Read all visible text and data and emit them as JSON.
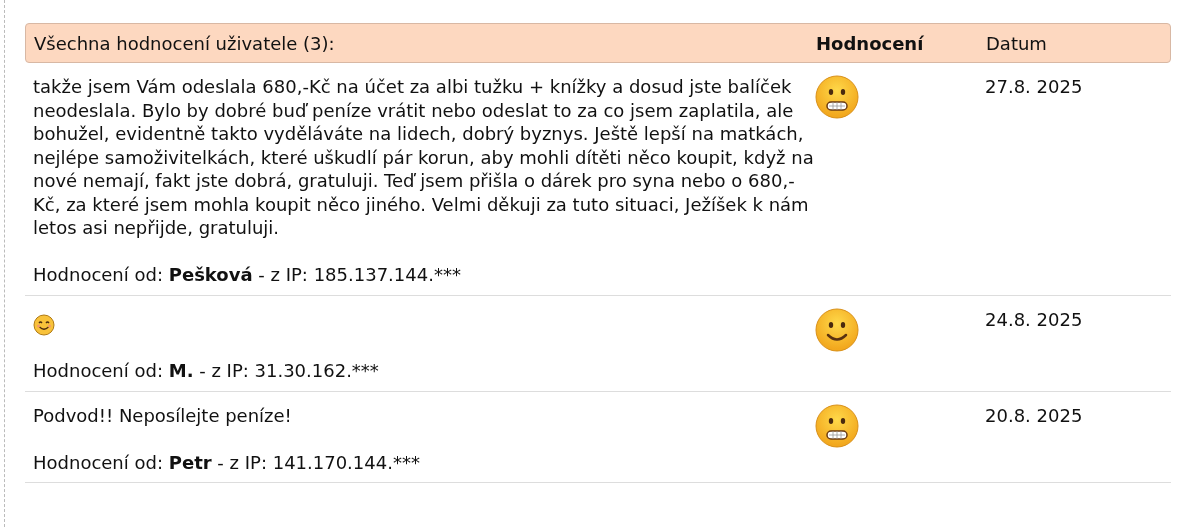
{
  "header": {
    "title": "Všechna hodnocení uživatele (3):",
    "rating": "Hodnocení",
    "date": "Datum"
  },
  "reviews": [
    {
      "comment": {
        "kind": "text",
        "text": "takže jsem Vám odeslala 680,-Kč na účet za albi tužku + knížky a dosud jste balíček neodeslala. Bylo by dobré buď peníze vrátit nebo odeslat to za co jsem zaplatila, ale bohužel, evidentně takto vyděláváte na lidech, dobrý byznys. Ještě lepší na matkách, nejlépe samoživitelkách, které uškudlí pár korun, aby mohli dítěti něco koupit, když na nové nemají, fakt jste dobrá, gratuluji. Teď jsem přišla o dárek pro syna nebo o 680,-Kč, za které jsem mohla koupit něco jiného. Velmi děkuji za tuto situaci, Ježíšek k nám letos asi nepřijde, gratuluji."
      },
      "author": "Hodnocení od: **Pešková** - z IP: 185.137.144.***",
      "rating": {
        "kind": "grimace"
      },
      "date": "27.8. 2025"
    },
    {
      "comment": {
        "kind": "emoji"
      },
      "author": "Hodnocení od: **M.** - z IP: 31.30.162.***",
      "rating": {
        "kind": "smile"
      },
      "date": "24.8. 2025"
    },
    {
      "comment": {
        "kind": "text",
        "text": "Podvod!! Neposílejte peníze!"
      },
      "author": "Hodnocení od: **Petr** - z IP: 141.170.144.***",
      "rating": {
        "kind": "grimace"
      },
      "date": "20.8. 2025"
    }
  ]
}
